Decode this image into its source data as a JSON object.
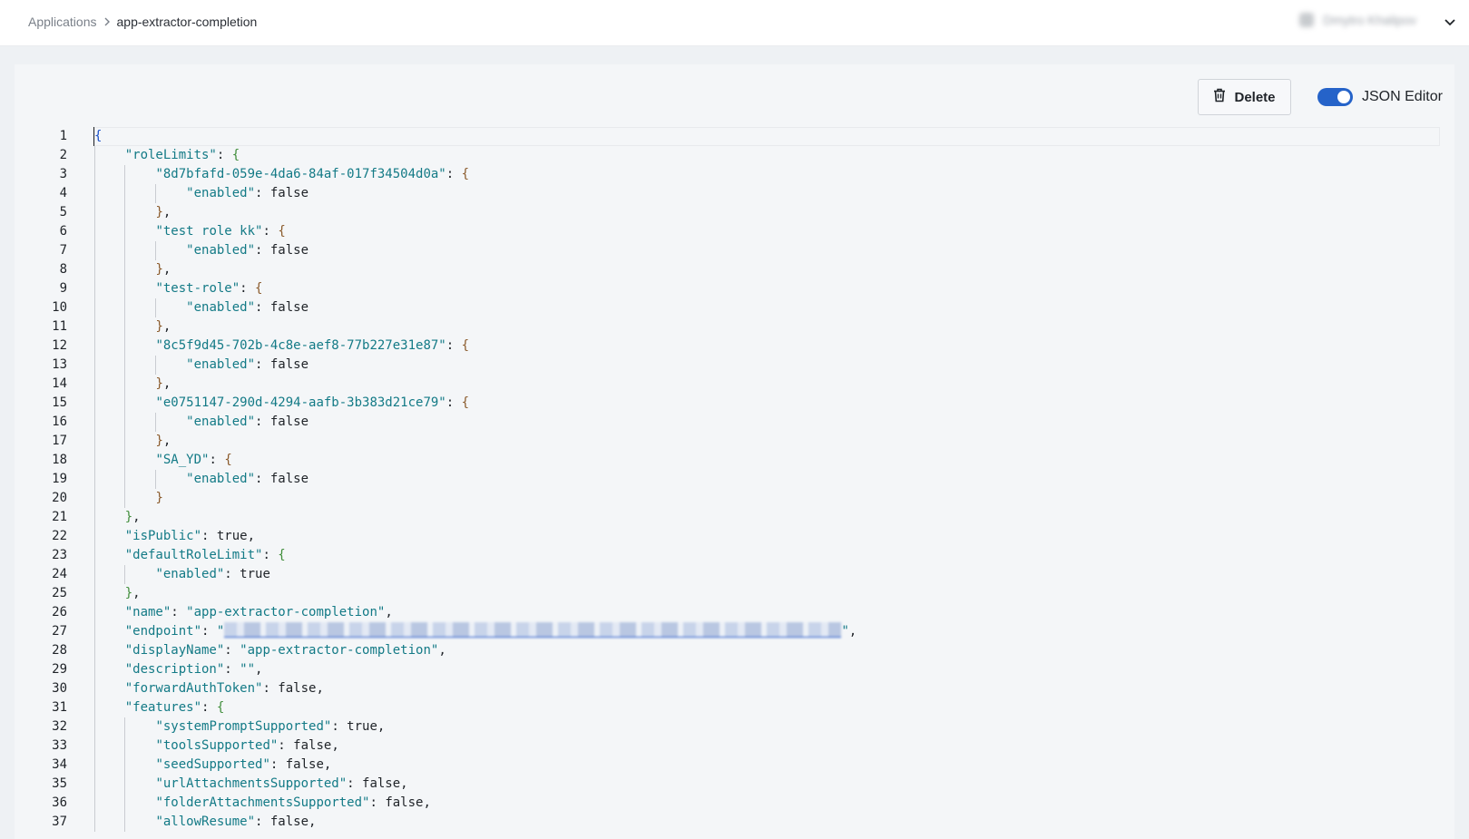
{
  "header": {
    "breadcrumb_root": "Applications",
    "breadcrumb_current": "app-extractor-completion",
    "user_name": "Dmytro Khalipov"
  },
  "toolbar": {
    "delete_label": "Delete",
    "json_editor_label": "JSON Editor",
    "json_editor_enabled": true
  },
  "colors": {
    "accent": "#2563c9",
    "key": "#137a86",
    "brace_level1": "#1a50c8",
    "brace_level2": "#3f8d3a",
    "brace_level3": "#8a5a2b"
  },
  "editor": {
    "line_numbers": [
      "1",
      "2",
      "3",
      "4",
      "5",
      "6",
      "7",
      "8",
      "9",
      "10",
      "11",
      "12",
      "13",
      "14",
      "15",
      "16",
      "17",
      "18",
      "19",
      "20",
      "21",
      "22",
      "23",
      "24",
      "25",
      "26",
      "27",
      "28",
      "29",
      "30",
      "31",
      "32",
      "33",
      "34",
      "35",
      "36",
      "37"
    ],
    "code": {
      "l1_open": "{",
      "roleLimits_key": "\"roleLimits\"",
      "role1_key": "\"8d7bfafd-059e-4da6-84af-017f34504d0a\"",
      "role2_key": "\"test role kk\"",
      "role3_key": "\"test-role\"",
      "role4_key": "\"8c5f9d45-702b-4c8e-aef8-77b227e31e87\"",
      "role5_key": "\"e0751147-290d-4294-aafb-3b383d21ce79\"",
      "role6_key": "\"SA_YD\"",
      "enabled_key": "\"enabled\"",
      "false_val": "false",
      "true_val": "true",
      "isPublic_key": "\"isPublic\"",
      "defaultRoleLimit_key": "\"defaultRoleLimit\"",
      "name_key": "\"name\"",
      "name_val": "\"app-extractor-completion\"",
      "endpoint_key": "\"endpoint\"",
      "displayName_key": "\"displayName\"",
      "displayName_val": "\"app-extractor-completion\"",
      "description_key": "\"description\"",
      "description_val": "\"\"",
      "forwardAuthToken_key": "\"forwardAuthToken\"",
      "features_key": "\"features\"",
      "systemPromptSupported_key": "\"systemPromptSupported\"",
      "toolsSupported_key": "\"toolsSupported\"",
      "seedSupported_key": "\"seedSupported\"",
      "urlAttachmentsSupported_key": "\"urlAttachmentsSupported\"",
      "folderAttachmentsSupported_key": "\"folderAttachmentsSupported\"",
      "allowResume_key": "\"allowResume\""
    }
  }
}
